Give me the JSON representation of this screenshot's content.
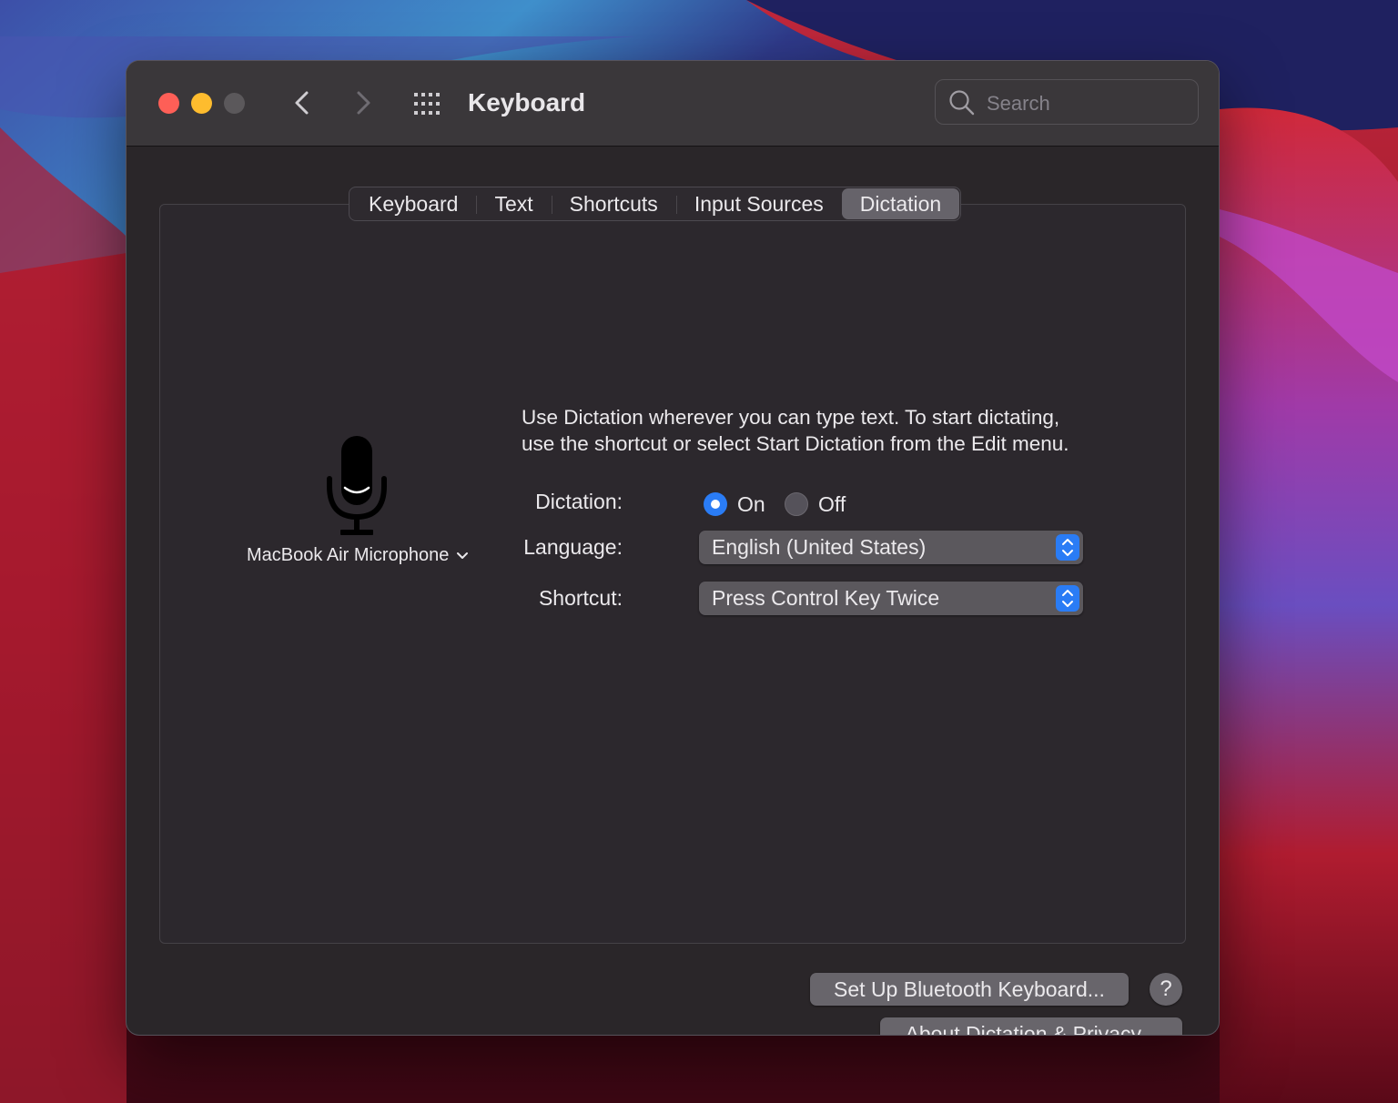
{
  "window": {
    "title": "Keyboard"
  },
  "titlebar": {
    "search": {
      "placeholder": "Search",
      "value": ""
    },
    "icons": [
      "close-button",
      "minimize-button",
      "zoom-button",
      "chevron-left-icon",
      "chevron-right-icon",
      "grid-icon"
    ]
  },
  "tabs": [
    {
      "label": "Keyboard",
      "active": false
    },
    {
      "label": "Text",
      "active": false
    },
    {
      "label": "Shortcuts",
      "active": false
    },
    {
      "label": "Input Sources",
      "active": false
    },
    {
      "label": "Dictation",
      "active": true
    }
  ],
  "microphone": {
    "icon": "microphone-icon",
    "source_label": "MacBook Air Microphone"
  },
  "description": {
    "line1": "Use Dictation wherever you can type text. To start dictating,",
    "line2": "use the shortcut or select Start Dictation from the Edit menu."
  },
  "form": {
    "dictation_label": "Dictation:",
    "on_label": "On",
    "off_label": "Off",
    "selected": "On",
    "language_label": "Language:",
    "language_value": "English (United States)",
    "shortcut_label": "Shortcut:",
    "shortcut_value": "Press Control Key Twice"
  },
  "buttons": {
    "about": "About Dictation & Privacy...",
    "bluetooth": "Set Up Bluetooth Keyboard...",
    "help": "?"
  },
  "colors": {
    "accent": "#2a7cf5",
    "close": "#fe5f57",
    "minimize": "#febc2e",
    "zoom_disabled": "#5b585b"
  }
}
